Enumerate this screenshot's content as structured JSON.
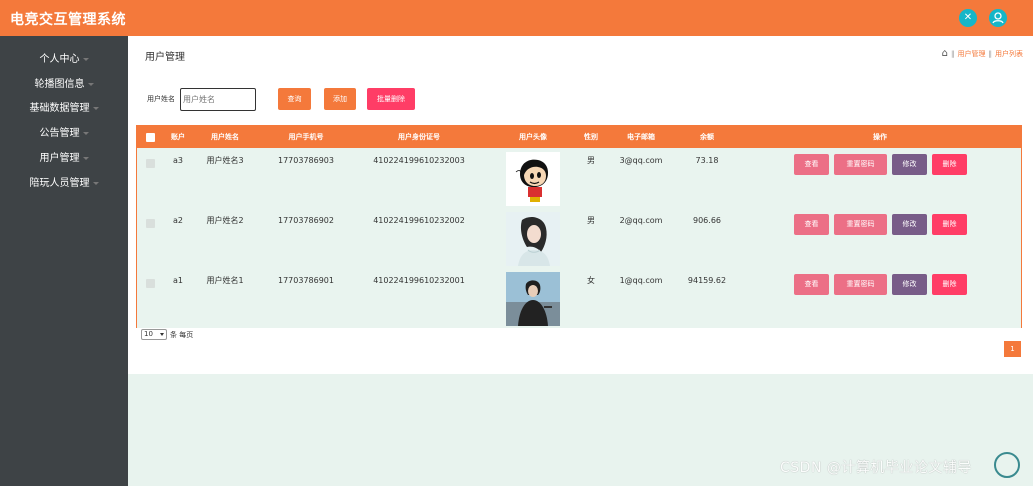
{
  "app": {
    "title": "电竞交互管理系统"
  },
  "topbar": {
    "icons": [
      "expand-icon",
      "user-icon"
    ]
  },
  "sidebar": {
    "items": [
      {
        "label": "个人中心",
        "has_caret": true
      },
      {
        "label": "轮播图信息",
        "has_caret": true
      },
      {
        "label": "基础数据管理",
        "has_caret": true
      },
      {
        "label": "公告管理",
        "has_caret": true
      },
      {
        "label": "用户管理",
        "has_caret": true
      },
      {
        "label": "陪玩人员管理",
        "has_caret": true
      }
    ]
  },
  "page": {
    "title": "用户管理",
    "breadcrumb": [
      "用户管理",
      "用户列表"
    ]
  },
  "search": {
    "label": "用户姓名",
    "placeholder": "用户姓名",
    "search_button": "查询",
    "add_button": "添加",
    "batch_delete_button": "批量删除"
  },
  "table": {
    "columns": [
      "账户",
      "用户姓名",
      "用户手机号",
      "用户身份证号",
      "用户头像",
      "性别",
      "电子邮箱",
      "余额",
      "操作"
    ],
    "rows": [
      {
        "account": "a3",
        "name": "用户姓名3",
        "phone": "17703786903",
        "id_card": "410224199610232003",
        "avatar": "cartoon-avatar",
        "gender": "男",
        "email": "3@qq.com",
        "balance": "73.18"
      },
      {
        "account": "a2",
        "name": "用户姓名2",
        "phone": "17703786902",
        "id_card": "410224199610232002",
        "avatar": "woman-portrait-avatar",
        "gender": "男",
        "email": "2@qq.com",
        "balance": "906.66"
      },
      {
        "account": "a1",
        "name": "用户姓名1",
        "phone": "17703786901",
        "id_card": "410224199610232001",
        "avatar": "man-outdoor-avatar",
        "gender": "女",
        "email": "1@qq.com",
        "balance": "94159.62"
      }
    ],
    "actions": {
      "view": "查看",
      "reset": "重置密码",
      "edit": "修改",
      "delete": "删除"
    },
    "colors": {
      "header": "#f4793b",
      "row_bg": "#e9f4ef",
      "view": "#ec6f86",
      "edit": "#785c88",
      "delete": "#ff3d66"
    }
  },
  "pagination": {
    "page_size": "10",
    "page_size_label": "条 每页",
    "current_page": "1"
  },
  "watermark": "CSDN @计算机毕业论文辅导"
}
